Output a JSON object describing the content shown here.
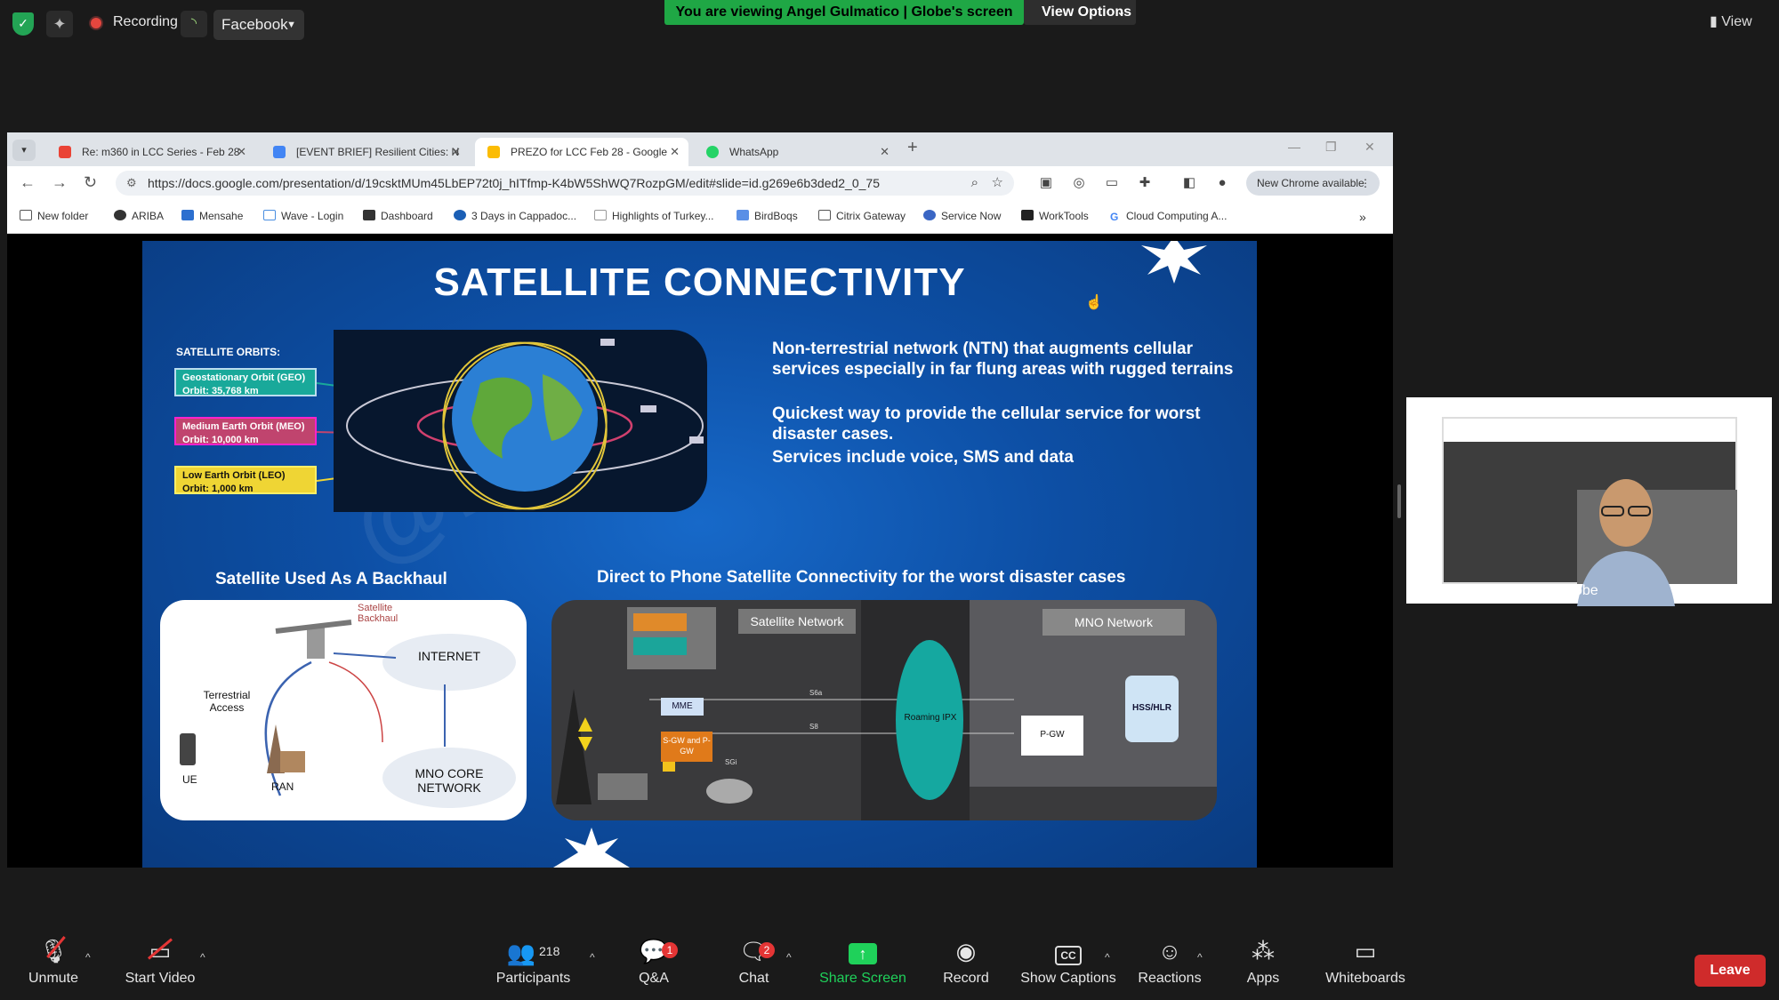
{
  "topbar": {
    "recording_label": "Recording",
    "facebook_label": "Facebook",
    "viewing_banner": "You are viewing Angel Gulmatico | Globe's screen",
    "view_options_label": "View Options",
    "view_label": "View"
  },
  "browser": {
    "tabs": [
      {
        "label": "Re: m360 in LCC Series - Feb 28",
        "icon": "gmail-icon"
      },
      {
        "label": "[EVENT BRIEF] Resilient Cities: N",
        "icon": "docs-icon"
      },
      {
        "label": "PREZO for LCC Feb 28 - Google",
        "icon": "slides-icon"
      },
      {
        "label": "WhatsApp",
        "icon": "whatsapp-icon"
      }
    ],
    "url": "https://docs.google.com/presentation/d/19csktMUm45LbEP72t0j_hITfmp-K4bW5ShWQ7RozpGM/edit#slide=id.g269e6b3ded2_0_75",
    "new_chrome_label": "New Chrome available",
    "bookmarks": [
      "New folder",
      "ARIBA",
      "Mensahe",
      "Wave - Login",
      "Dashboard",
      "3 Days in Cappadoc...",
      "Highlights of Turkey...",
      "BirdBoqs",
      "Citrix Gateway",
      "Service Now",
      "WorkTools",
      "Cloud Computing A..."
    ]
  },
  "slide": {
    "title": "SATELLITE CONNECTIVITY",
    "orbits_heading": "SATELLITE ORBITS:",
    "orbits": [
      {
        "name": "Geostationary Orbit (GEO)",
        "value": "Orbit: 35,768 km"
      },
      {
        "name": "Medium Earth Orbit (MEO)",
        "value": "Orbit: 10,000 km"
      },
      {
        "name": "Low Earth Orbit (LEO)",
        "value": "Orbit: 1,000 km"
      }
    ],
    "desc1": "Non-terrestrial network (NTN) that augments cellular services especially in far flung areas with rugged terrains",
    "desc2": "Quickest way to provide the cellular service for worst disaster cases.",
    "desc3": "Services include voice, SMS and data",
    "backhaul_heading": "Satellite Used As A Backhaul",
    "d2p_heading": "Direct to Phone Satellite Connectivity for the worst disaster cases",
    "backhaul": {
      "satellite_backhaul": "Satellite Backhaul",
      "internet": "INTERNET",
      "terrestrial_access": "Terrestrial Access",
      "ue": "UE",
      "ran": "RAN",
      "mno_core": "MNO CORE NETWORK"
    },
    "d2p": {
      "satellite_network": "Satellite Network",
      "mno_network": "MNO Network",
      "mme": "MME",
      "sgw": "S-GW and P-GW",
      "roaming": "Roaming IPX",
      "pgw": "P-GW",
      "hss": "HSS/HLR",
      "s6a": "S6a",
      "s8": "S8",
      "sgi": "SGi"
    }
  },
  "video": {
    "name": "Angel Gulmatico | Globe"
  },
  "bottombar": {
    "unmute": "Unmute",
    "start_video": "Start Video",
    "participants": "Participants",
    "participants_count": "218",
    "qa": "Q&A",
    "qa_badge": "1",
    "chat": "Chat",
    "chat_badge": "2",
    "share_screen": "Share Screen",
    "record": "Record",
    "show_captions": "Show Captions",
    "reactions": "Reactions",
    "apps": "Apps",
    "whiteboards": "Whiteboards",
    "leave": "Leave"
  },
  "colors": {
    "banner_green": "#1fa745",
    "share_green": "#1fd15a",
    "leave_red": "#cf2b2b",
    "slide_blue": "#0d4fa5"
  }
}
